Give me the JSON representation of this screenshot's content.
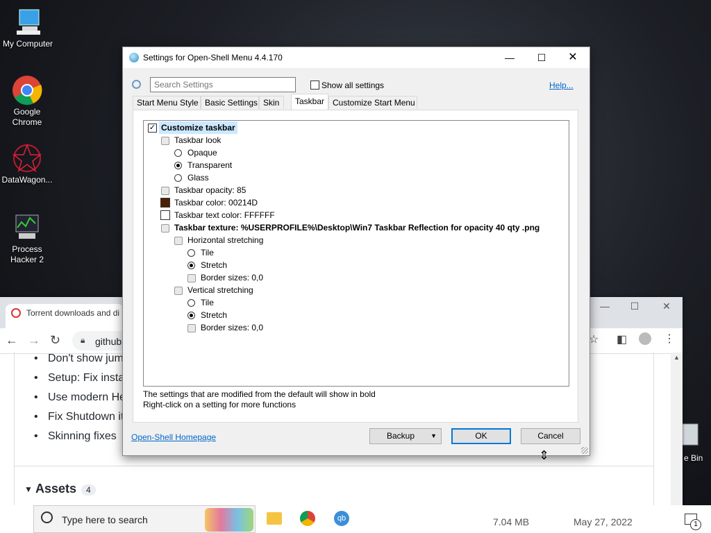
{
  "desktop": {
    "icons": [
      {
        "label": "My Computer"
      },
      {
        "label": "Google Chrome"
      },
      {
        "label": "DataWagon..."
      },
      {
        "label": "Process Hacker 2"
      }
    ],
    "recycle_bin_partial": "e Bin"
  },
  "browser": {
    "tab_title": "Torrent downloads and di",
    "url_partial": "github",
    "bullets": [
      "Don't show jum",
      "Setup: Fix instal",
      "Use modern He",
      "Fix Shutdown it",
      "Skinning fixes"
    ],
    "assets_label": "Assets",
    "assets_count": "4",
    "asset_size": "7.04 MB",
    "asset_date": "May 27, 2022"
  },
  "dialog": {
    "title": "Settings for Open-Shell Menu 4.4.170",
    "search_placeholder": "Search Settings",
    "show_all_label": "Show all settings",
    "help_link": "Help...",
    "tabs": [
      "Start Menu Style",
      "Basic Settings",
      "Skin",
      "Taskbar",
      "Customize Start Menu"
    ],
    "active_tab": "Taskbar",
    "tree": {
      "customize_taskbar": "Customize taskbar",
      "taskbar_look": "Taskbar look",
      "opaque": "Opaque",
      "transparent": "Transparent",
      "glass": "Glass",
      "opacity": "Taskbar opacity: 85",
      "color": "Taskbar color: 00214D",
      "text_color": "Taskbar text color: FFFFFF",
      "texture": "Taskbar texture: %USERPROFILE%\\Desktop\\Win7 Taskbar Reflection for opacity 40 qty .png",
      "h_stretch": "Horizontal stretching",
      "h_tile": "Tile",
      "h_stretch_opt": "Stretch",
      "h_border": "Border sizes: 0,0",
      "v_stretch": "Vertical stretching",
      "v_tile": "Tile",
      "v_stretch_opt": "Stretch",
      "v_border": "Border sizes: 0,0"
    },
    "note_line1": "The settings that are modified from the default will show in bold",
    "note_line2": "Right-click on a setting for more functions",
    "homepage_link": "Open-Shell Homepage",
    "backup_label": "Backup",
    "ok_label": "OK",
    "cancel_label": "Cancel"
  },
  "taskbar": {
    "search_placeholder": "Type here to search",
    "notification_count": "1"
  },
  "colors": {
    "taskbar_swatch": "#4D2100",
    "text_swatch": "#FFFFFF"
  }
}
